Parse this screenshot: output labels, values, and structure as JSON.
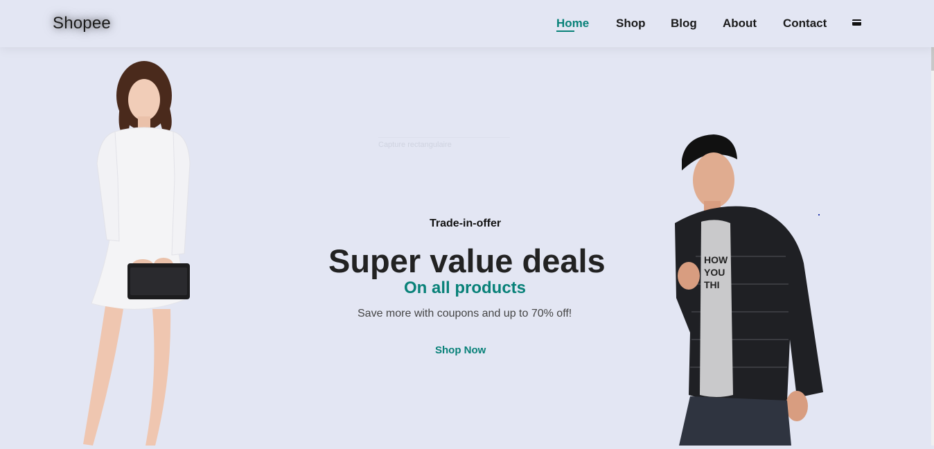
{
  "header": {
    "logo": "Shopee",
    "nav": [
      {
        "label": "Home",
        "active": true
      },
      {
        "label": "Shop",
        "active": false
      },
      {
        "label": "Blog",
        "active": false
      },
      {
        "label": "About",
        "active": false
      },
      {
        "label": "Contact",
        "active": false
      }
    ],
    "cart_icon": "cart-icon"
  },
  "hero": {
    "eyebrow": "Trade-in-offer",
    "headline": "Super value deals",
    "subheadline": "On all products",
    "tagline": "Save more with coupons and up to 70% off!",
    "cta_label": "Shop Now",
    "ghost_tooltip": "Capture rectangulaire"
  },
  "colors": {
    "accent": "#088178",
    "background": "#e3e6f3",
    "text_dark": "#222222"
  }
}
